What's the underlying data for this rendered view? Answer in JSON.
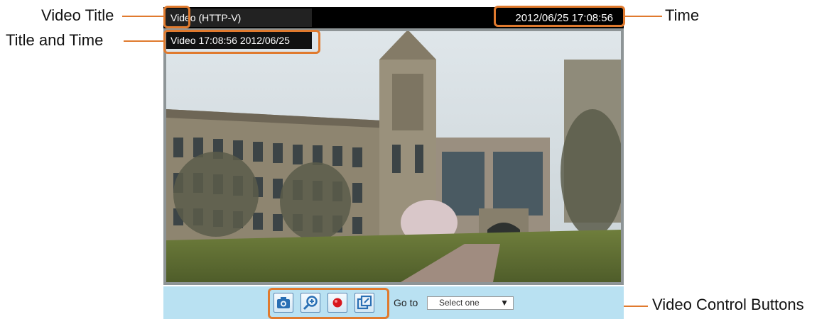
{
  "viewer": {
    "video_title": "Video",
    "stream_type": "(HTTP-V)",
    "datetime": "2012/06/25  17:08:56",
    "overlay_text": "Video 17:08:56  2012/06/25"
  },
  "controls": {
    "buttons": [
      "snapshot-icon",
      "digital-zoom-icon",
      "record-icon",
      "fullscreen-icon"
    ],
    "goto_label": "Go to",
    "select_value": "Select one"
  },
  "callouts": {
    "video_title": "Video Title",
    "title_and_time": "Title and Time",
    "time": "Time",
    "video_control_buttons": "Video Control Buttons"
  },
  "colors": {
    "callout": "#e07a2e",
    "controlbar_bg": "#b9e1f2",
    "titlebar_bg": "#000000"
  }
}
